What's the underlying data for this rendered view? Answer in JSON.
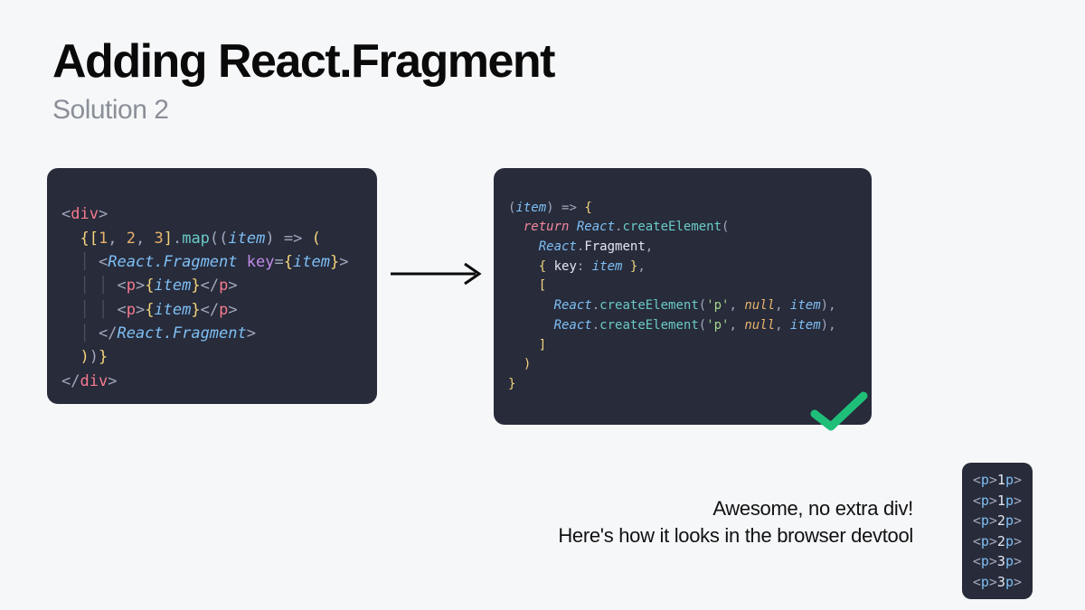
{
  "title": "Adding React.Fragment",
  "subtitle": "Solution 2",
  "caption": "Awesome, no extra div!\nHere's how it looks in the browser devtool",
  "code_left": {
    "line1": {
      "open": "<",
      "tag": "div",
      "close": ">"
    },
    "line2": {
      "lb": "{",
      "lbrack": "[",
      "n1": "1",
      "c": ", ",
      "n2": "2",
      "n3": "3",
      "rbrack": "]",
      "dot": ".",
      "map": "map",
      "lp": "((",
      "item": "item",
      "rp": ")",
      "arrow": " => ",
      "paren": "("
    },
    "line3": {
      "open": "<",
      "tag": "React.Fragment",
      "sp": " ",
      "attr": "key",
      "eq": "=",
      "lb": "{",
      "val": "item",
      "rb": "}",
      "close": ">"
    },
    "line4": {
      "open": "<",
      "p": "p",
      "close": ">",
      "lb": "{",
      "item": "item",
      "rb": "}",
      "copen": "</",
      "cclose": ">"
    },
    "line5": {
      "open": "<",
      "p": "p",
      "close": ">",
      "lb": "{",
      "item": "item",
      "rb": "}",
      "copen": "</",
      "cclose": ">"
    },
    "line6": {
      "open": "</",
      "tag": "React.Fragment",
      "close": ">"
    },
    "line7": {
      "rp": ")",
      "rpp": ")",
      "rb": "}"
    },
    "line8": {
      "open": "</",
      "tag": "div",
      "close": ">"
    }
  },
  "code_right": {
    "line1": {
      "lp": "(",
      "item": "item",
      "rp": ")",
      "arrow": " => ",
      "lb": "{"
    },
    "line2": {
      "ret": "return",
      "sp": " ",
      "react": "React",
      "dot": ".",
      "ce": "createElement",
      "lp": "("
    },
    "line3": {
      "react": "React",
      "dot": ".",
      "frag": "Fragment",
      "comma": ","
    },
    "line4": {
      "lb": "{",
      "sp": " ",
      "key": "key",
      "colon": ": ",
      "item": "item",
      "sp2": " ",
      "rb": "}",
      "comma": ","
    },
    "line5": {
      "lbrack": "["
    },
    "line6": {
      "react": "React",
      "dot": ".",
      "ce": "createElement",
      "lp": "(",
      "str": "'p'",
      "c1": ", ",
      "null": "null",
      "c2": ", ",
      "item": "item",
      "rp": ")",
      "comma": ","
    },
    "line7": {
      "react": "React",
      "dot": ".",
      "ce": "createElement",
      "lp": "(",
      "str": "'p'",
      "c1": ", ",
      "null": "null",
      "c2": ", ",
      "item": "item",
      "rp": ")",
      "comma": ","
    },
    "line8": {
      "rbrack": "]"
    },
    "line9": {
      "rp": ")"
    },
    "line10": {
      "rb": "}"
    }
  },
  "devtool": {
    "rows": [
      {
        "open": "<",
        "tag": "p",
        "close": ">",
        "txt": "1",
        "copen": "</",
        "cclose": ">"
      },
      {
        "open": "<",
        "tag": "p",
        "close": ">",
        "txt": "1",
        "copen": "</",
        "cclose": ">"
      },
      {
        "open": "<",
        "tag": "p",
        "close": ">",
        "txt": "2",
        "copen": "</",
        "cclose": ">"
      },
      {
        "open": "<",
        "tag": "p",
        "close": ">",
        "txt": "2",
        "copen": "</",
        "cclose": ">"
      },
      {
        "open": "<",
        "tag": "p",
        "close": ">",
        "txt": "3",
        "copen": "</",
        "cclose": ">"
      },
      {
        "open": "<",
        "tag": "p",
        "close": ">",
        "txt": "3",
        "copen": "</",
        "cclose": ">"
      }
    ]
  },
  "colors": {
    "bg": "#f6f7f9",
    "code_bg": "#272b3a",
    "check": "#1fbf7a"
  }
}
